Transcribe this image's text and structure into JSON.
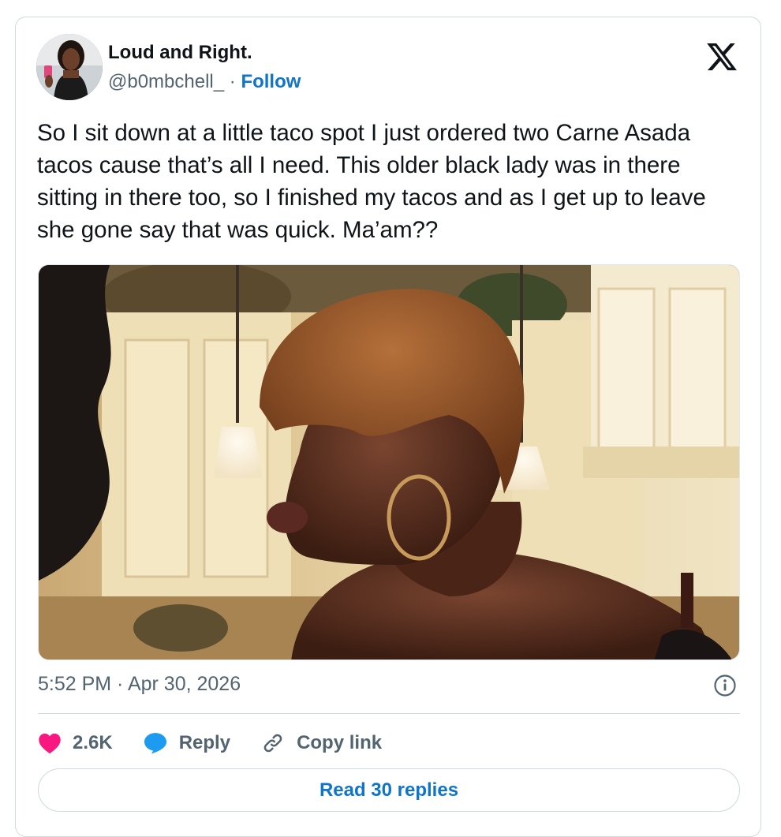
{
  "author": {
    "display_name": "Loud and Right.",
    "handle": "@b0mbchell_",
    "separator": " · ",
    "follow_label": "Follow"
  },
  "tweet": {
    "text": "So I sit down at a little taco spot I just ordered two Carne Asada tacos cause that’s all I need. This older black lady was in there sitting in there too, so I finished my tacos and as I get up to leave she gone say that was quick.  Ma’am??"
  },
  "media": {
    "description_icon": "photo-icon"
  },
  "meta": {
    "timestamp": "5:52 PM · Apr 30, 2026",
    "info_icon": "info-icon"
  },
  "actions": {
    "likes_count": "2.6K",
    "reply_label": "Reply",
    "copy_link_label": "Copy link"
  },
  "footer": {
    "read_replies_label": "Read 30 replies"
  },
  "colors": {
    "accent": "#0f75c8",
    "like": "#f91880",
    "reply_bubble": "#1d9bf0",
    "muted": "#536471"
  }
}
